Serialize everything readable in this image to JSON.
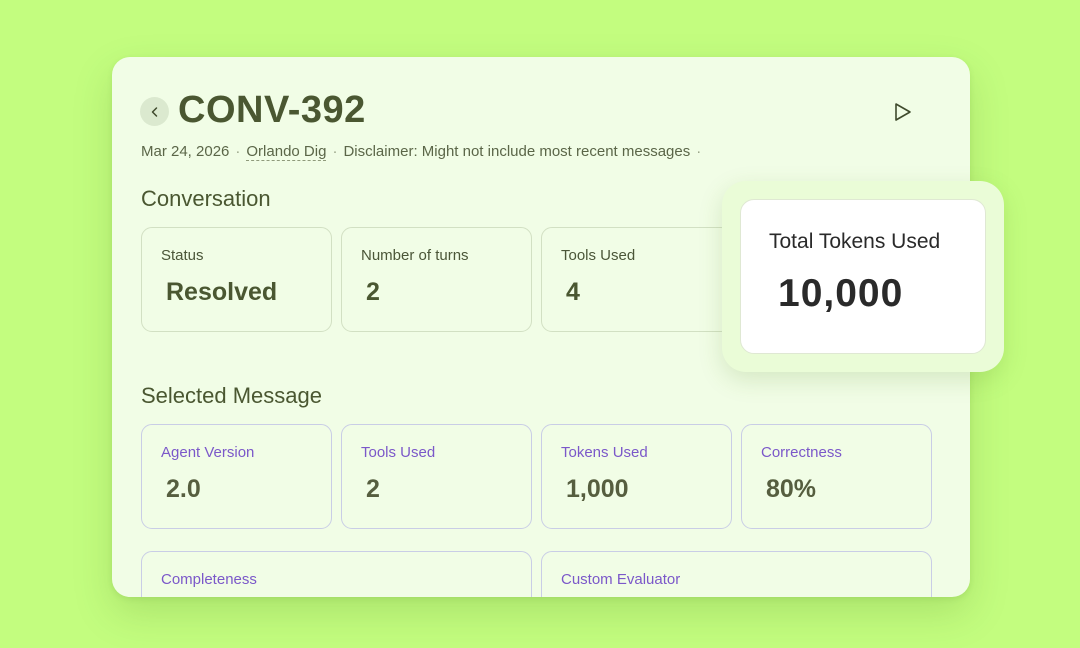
{
  "header": {
    "title": "CONV-392",
    "date": "Mar 24, 2026",
    "separator": "·",
    "author": "Orlando Dig",
    "disclaimer": "Disclaimer: Might not include most recent messages"
  },
  "conversation": {
    "title": "Conversation",
    "stats": [
      {
        "label": "Status",
        "value": "Resolved"
      },
      {
        "label": "Number of turns",
        "value": "2"
      },
      {
        "label": "Tools Used",
        "value": "4"
      }
    ]
  },
  "total_tokens": {
    "label": "Total Tokens Used",
    "value": "10,000"
  },
  "selected_message": {
    "title": "Selected Message",
    "stats": [
      {
        "label": "Agent Version",
        "value": "2.0"
      },
      {
        "label": "Tools Used",
        "value": "2"
      },
      {
        "label": "Tokens Used",
        "value": "1,000"
      },
      {
        "label": "Correctness",
        "value": "80%"
      }
    ],
    "more": [
      {
        "label": "Completeness"
      },
      {
        "label": "Custom Evaluator"
      }
    ]
  },
  "colors": {
    "background": "#c3fd7f",
    "card": "#f1fde6",
    "heading": "#4a5731",
    "accent_purple": "#7b58c9"
  },
  "icons": {
    "back": "chevron-left-icon",
    "play": "play-icon"
  }
}
